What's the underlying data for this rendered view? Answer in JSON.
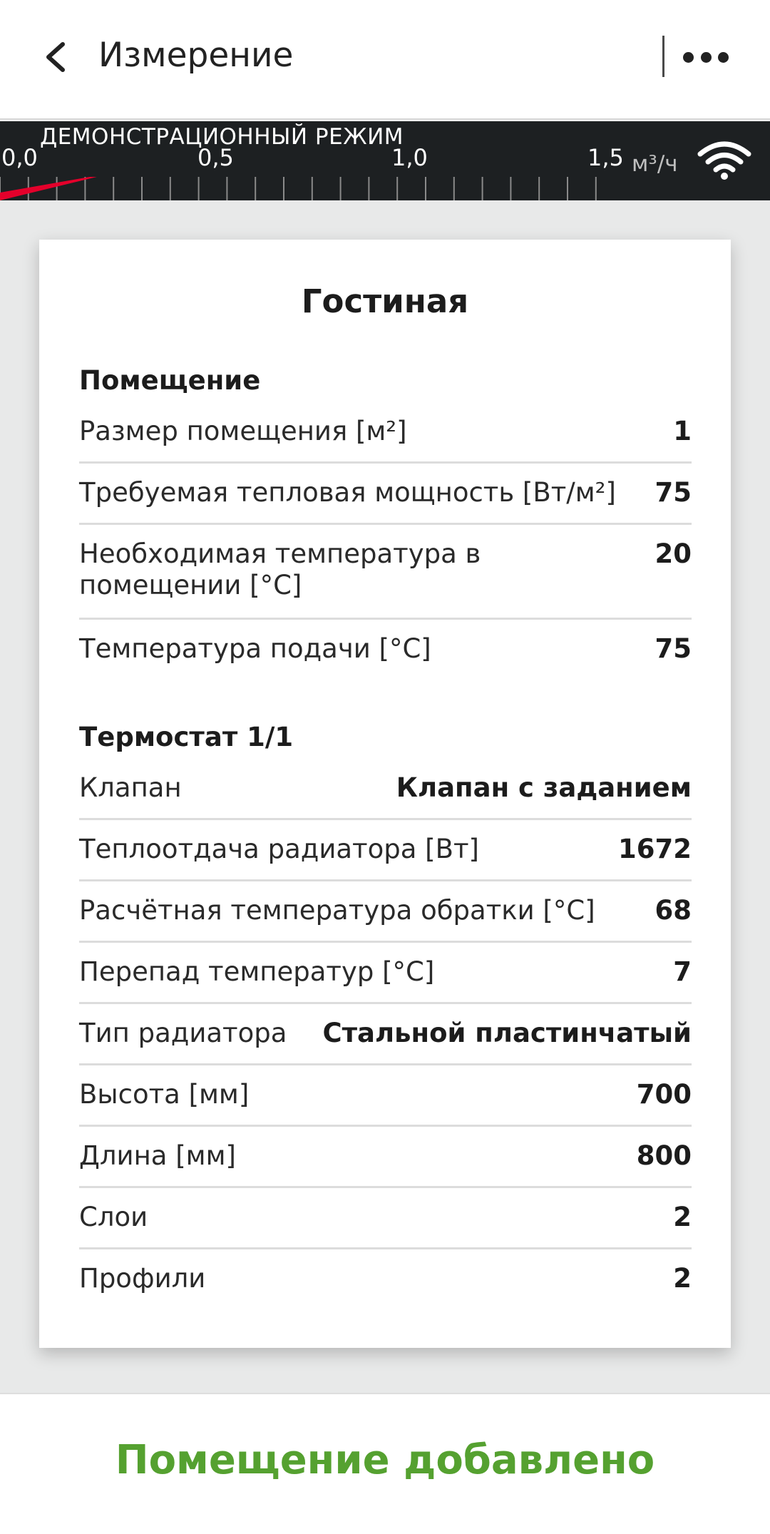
{
  "header": {
    "title": "Измерение"
  },
  "flowbar": {
    "mode_label": "ДЕМОНСТРАЦИОННЫЙ РЕЖИМ",
    "ticks": [
      "0,0",
      "0,5",
      "1,0",
      "1,5"
    ],
    "unit": "м³/ч",
    "current_flow_fraction": 0.06,
    "indicator_color": "#e4002b"
  },
  "card": {
    "title": "Гостиная",
    "room_section": {
      "title": "Помещение",
      "rows": [
        {
          "label": "Размер помещения [м²]",
          "value": "1"
        },
        {
          "label": "Требуемая тепловая мощность [Вт/м²]",
          "value": "75"
        },
        {
          "label": "Необходимая температура в помещении [°C]",
          "value": "20"
        },
        {
          "label": "Температура подачи [°C]",
          "value": "75"
        }
      ]
    },
    "thermostat_section": {
      "title": "Термостат 1/1",
      "rows": [
        {
          "label": "Клапан",
          "value": "Клапан с заданием"
        },
        {
          "label": "Теплоотдача радиатора [Вт]",
          "value": "1672"
        },
        {
          "label": "Расчётная температура обратки [°C]",
          "value": "68"
        },
        {
          "label": "Перепад температур [°C]",
          "value": "7"
        },
        {
          "label": "Тип радиатора",
          "value": "Стальной пластинчатый"
        },
        {
          "label": "Высота [мм]",
          "value": "700"
        },
        {
          "label": "Длина [мм]",
          "value": "800"
        },
        {
          "label": "Слои",
          "value": "2"
        },
        {
          "label": "Профили",
          "value": "2"
        }
      ]
    }
  },
  "footer": {
    "message": "Помещение добавлено",
    "message_color": "#55a130"
  },
  "icons": {
    "back": "chevron-left-icon",
    "more": "more-horizontal-icon",
    "wifi": "wifi-icon"
  }
}
